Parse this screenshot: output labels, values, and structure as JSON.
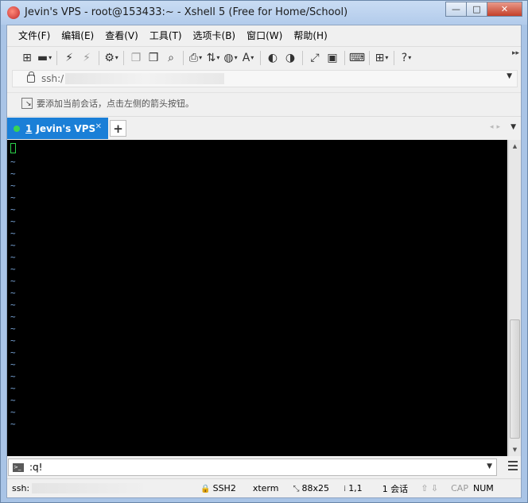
{
  "window": {
    "title": "Jevin's VPS - root@153433:~ - Xshell 5 (Free for Home/School)",
    "buttons": {
      "minimize": "—",
      "maximize": "□",
      "close": "✕"
    }
  },
  "menu": [
    "文件(F)",
    "编辑(E)",
    "查看(V)",
    "工具(T)",
    "选项卡(B)",
    "窗口(W)",
    "帮助(H)"
  ],
  "address": {
    "prefix": "ssh:/"
  },
  "hint": {
    "text": "要添加当前会话，点击左侧的箭头按钮。"
  },
  "tabs": [
    {
      "number": "1",
      "label": "Jevin's VPS",
      "active": true,
      "status_color": "#39d353"
    }
  ],
  "tab_add": "+",
  "terminal": {
    "tilde": "~",
    "tilde_count": 23,
    "cursor_color": "#2bd04a"
  },
  "command_input": {
    "value": ":q!"
  },
  "status": {
    "connection": "ssh:",
    "protocol": "SSH2",
    "terminal_type": "xterm",
    "size": "88x25",
    "position": "1,1",
    "sessions": "1 会话",
    "cap": "CAP",
    "num": "NUM"
  },
  "colors": {
    "tab_active": "#1a7fd7",
    "terminal_bg": "#000000",
    "tilde": "#7aa6da"
  }
}
